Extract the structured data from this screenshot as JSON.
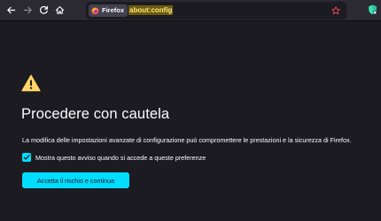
{
  "browser": {
    "identity_label": "Firefox",
    "url_highlight": "about:config",
    "url_rest": "",
    "icons": {
      "back": "back-arrow-icon",
      "forward": "forward-arrow-icon",
      "reload": "reload-icon",
      "home": "home-icon",
      "identity": "firefox-logo-icon",
      "bookmark": "star-icon",
      "extension": "shield-extension-icon"
    }
  },
  "page": {
    "warning_icon": "warning-triangle-icon",
    "title": "Procedere con cautela",
    "description": "La modifica delle impostazioni avanzate di configurazione può compromettere le prestazioni e la sicurezza di Firefox.",
    "checkbox_label": "Mostra questo avviso quando si accede a queste preferenze",
    "checkbox_checked": true,
    "accept_button": "Accetta il rischio e continua"
  },
  "colors": {
    "page_background": "#1c1b22",
    "toolbar_background": "#2b2a33",
    "accent": "#00ddff",
    "warning": "#ffd567",
    "url_highlight_bg": "#6b5a10",
    "url_highlight_text": "#ffe77a",
    "bookmark_star": "#ff4f5e"
  }
}
